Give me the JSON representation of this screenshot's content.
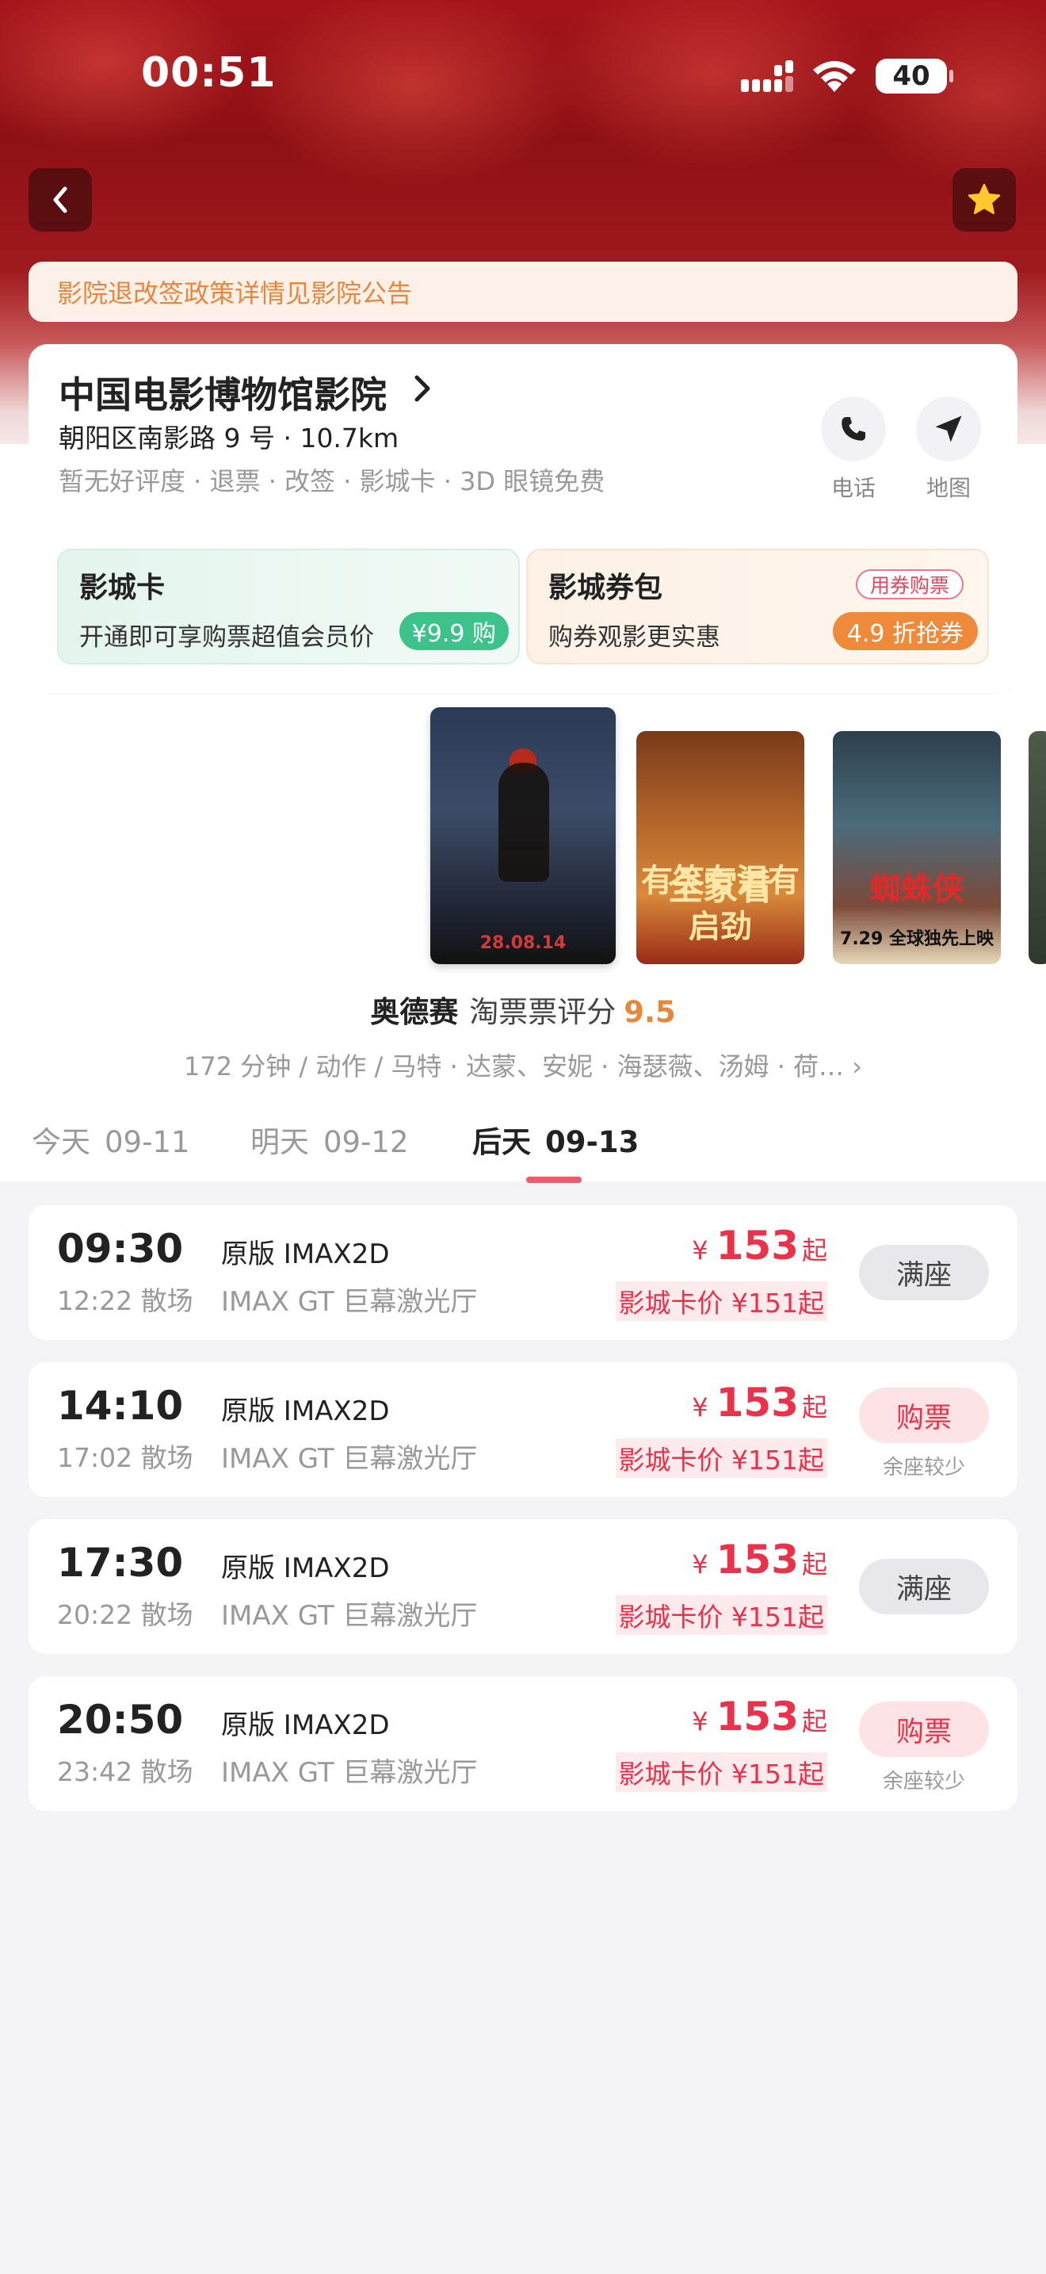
{
  "status_bar": {
    "time": "00:51",
    "battery": "40"
  },
  "notice": "影院退改签政策详情见影院公告",
  "cinema": {
    "name": "中国电影博物馆影院",
    "address": "朝阳区南影路 9 号 · 10.7km",
    "tags": "暂无好评度 · 退票 · 改签 · 影城卡 · 3D 眼镜免费",
    "actions": {
      "phone": "电话",
      "map": "地图"
    }
  },
  "promos": {
    "card": {
      "title": "影城卡",
      "subtitle": "开通即可享购票超值会员价",
      "badge": "¥9.9 购"
    },
    "coupon": {
      "title": "影城券包",
      "subtitle": "购券观影更实惠",
      "tag": "用券购票",
      "badge": "4.9 折抢券"
    }
  },
  "posters": [
    {
      "caption": "28.08.14"
    },
    {
      "caption_top": "全家看",
      "caption_bottom": "有笑有泪有启劲"
    },
    {
      "caption_top": "蜘蛛侠",
      "caption_bottom": "7.29 全球独先上映"
    }
  ],
  "movie": {
    "name": "奥德赛",
    "rating_label": "淘票票评分",
    "rating": "9.5",
    "meta": "172 分钟 / 动作 / 马特 · 达蒙、安妮 · 海瑟薇、汤姆 · 荷… ›"
  },
  "date_tabs": [
    {
      "day": "今天",
      "date": "09-11"
    },
    {
      "day": "明天",
      "date": "09-12"
    },
    {
      "day": "后天",
      "date": "09-13",
      "active": true
    }
  ],
  "showtimes": [
    {
      "start": "09:30",
      "end": "12:22 散场",
      "version": "原版 IMAX2D",
      "hall": "IMAX GT 巨幕激光厅",
      "currency": "¥",
      "price": "153",
      "from": "起",
      "card_price": "影城卡价 ¥151起",
      "button": "满座",
      "status": "full",
      "note": ""
    },
    {
      "start": "14:10",
      "end": "17:02 散场",
      "version": "原版 IMAX2D",
      "hall": "IMAX GT 巨幕激光厅",
      "currency": "¥",
      "price": "153",
      "from": "起",
      "card_price": "影城卡价 ¥151起",
      "button": "购票",
      "status": "buy",
      "note": "余座较少"
    },
    {
      "start": "17:30",
      "end": "20:22 散场",
      "version": "原版 IMAX2D",
      "hall": "IMAX GT 巨幕激光厅",
      "currency": "¥",
      "price": "153",
      "from": "起",
      "card_price": "影城卡价 ¥151起",
      "button": "满座",
      "status": "full",
      "note": ""
    },
    {
      "start": "20:50",
      "end": "23:42 散场",
      "version": "原版 IMAX2D",
      "hall": "IMAX GT 巨幕激光厅",
      "currency": "¥",
      "price": "153",
      "from": "起",
      "card_price": "影城卡价 ¥151起",
      "button": "购票",
      "status": "buy",
      "note": "余座较少"
    }
  ],
  "colors": {
    "accent": "#e8334a",
    "orange": "#e8873c",
    "green": "#3ec28b",
    "hero": "#a3141a"
  }
}
